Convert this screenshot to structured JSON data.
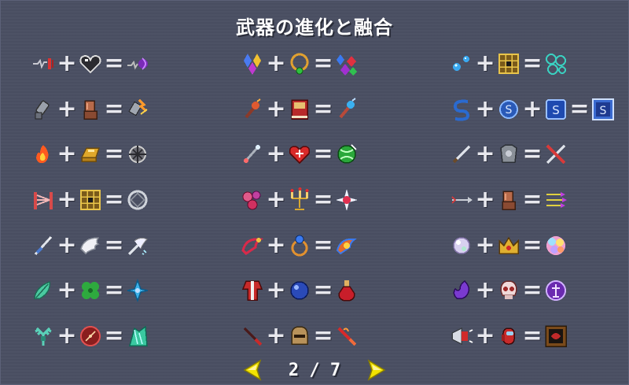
{
  "title": "武器の進化と融合",
  "pagination": {
    "text": "2 / 7",
    "current": 2,
    "total": 7
  },
  "colors": {
    "background": "#4a4f63",
    "arrow": "#f2e300",
    "text": "#ffffff"
  },
  "operators": {
    "plus": "+",
    "equals": "="
  },
  "columns": [
    {
      "rows": [
        [
          "whip-weapon",
          "heart-passive",
          "bloody-tear-evolution"
        ],
        [
          "gauntlet-weapon",
          "armor-glove-passive",
          "thunder-fist-evolution"
        ],
        [
          "fire-wand-weapon",
          "gold-ingot-passive",
          "hellfire-evolution"
        ],
        [
          "fence-weapon",
          "grid-passive",
          "clock-ring-evolution"
        ],
        [
          "feather-sword-weapon",
          "wings-passive",
          "feather-storm-evolution"
        ],
        [
          "leaf-weapon",
          "clover-passive",
          "crystal-leaf-evolution"
        ],
        [
          "antler-weapon",
          "compass-passive",
          "emerald-shard-evolution"
        ]
      ]
    },
    {
      "rows": [
        [
          "gems-weapon",
          "necklace-passive",
          "gem-cluster-evolution"
        ],
        [
          "torch-weapon",
          "spellbook-passive",
          "blue-torch-evolution"
        ],
        [
          "wand-weapon",
          "heart-cross-passive",
          "green-orb-evolution"
        ],
        [
          "bubble-orbs-weapon",
          "candelabra-passive",
          "star-burst-evolution"
        ],
        [
          "red-horn-weapon",
          "ring-passive",
          "fire-horn-evolution"
        ],
        [
          "red-robe-weapon",
          "blue-orb-passive",
          "red-potion-evolution"
        ],
        [
          "dagger-weapon",
          "helmet-passive",
          "flame-blade-evolution"
        ]
      ]
    },
    {
      "rows": [
        [
          "water-drops-weapon",
          "grid-passive",
          "bubble-cluster-evolution"
        ],
        [
          "snake-rune-weapon",
          "coin-rune-passive",
          "rune-tablet-passive",
          "rune-stone-evolution"
        ],
        [
          "sword-weapon",
          "armor-passive",
          "crossed-swords-evolution"
        ],
        [
          "arrow-weapon",
          "armor-glove-passive",
          "triple-arrow-evolution"
        ],
        [
          "pearl-weapon",
          "crown-passive",
          "rainbow-gem-evolution"
        ],
        [
          "purple-flame-weapon",
          "skull-passive",
          "purple-sigil-evolution"
        ],
        [
          "megaphone-weapon",
          "red-figure-passive",
          "framed-tablet-evolution"
        ]
      ]
    }
  ]
}
